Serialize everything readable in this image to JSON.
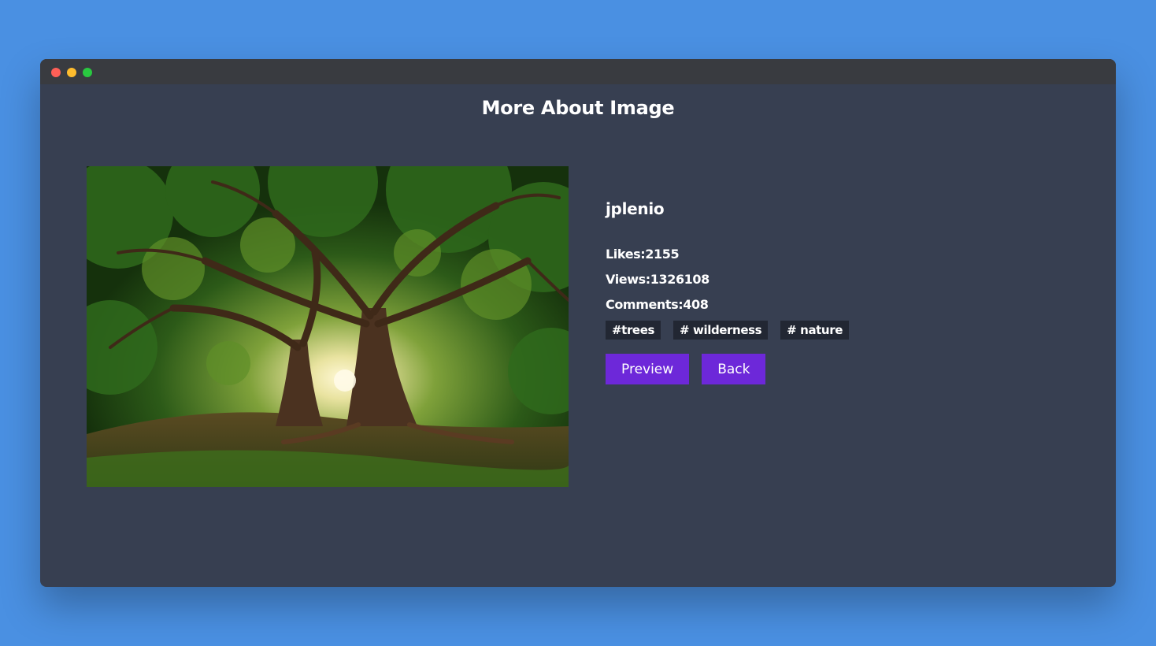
{
  "page": {
    "title": "More About Image"
  },
  "image": {
    "subject": "sunlit-tree-canopy-photo"
  },
  "details": {
    "username": "jplenio",
    "likes": "Likes:2155",
    "views": "Views:1326108",
    "comments": "Comments:408"
  },
  "tags": [
    "#trees",
    "# wilderness",
    "# nature"
  ],
  "actions": {
    "preview_label": "Preview",
    "back_label": "Back"
  },
  "colors": {
    "background": "#4a90e2",
    "window": "#373f51",
    "titlebar": "#393b40",
    "button": "#6d28d9",
    "tag": "#222733"
  }
}
